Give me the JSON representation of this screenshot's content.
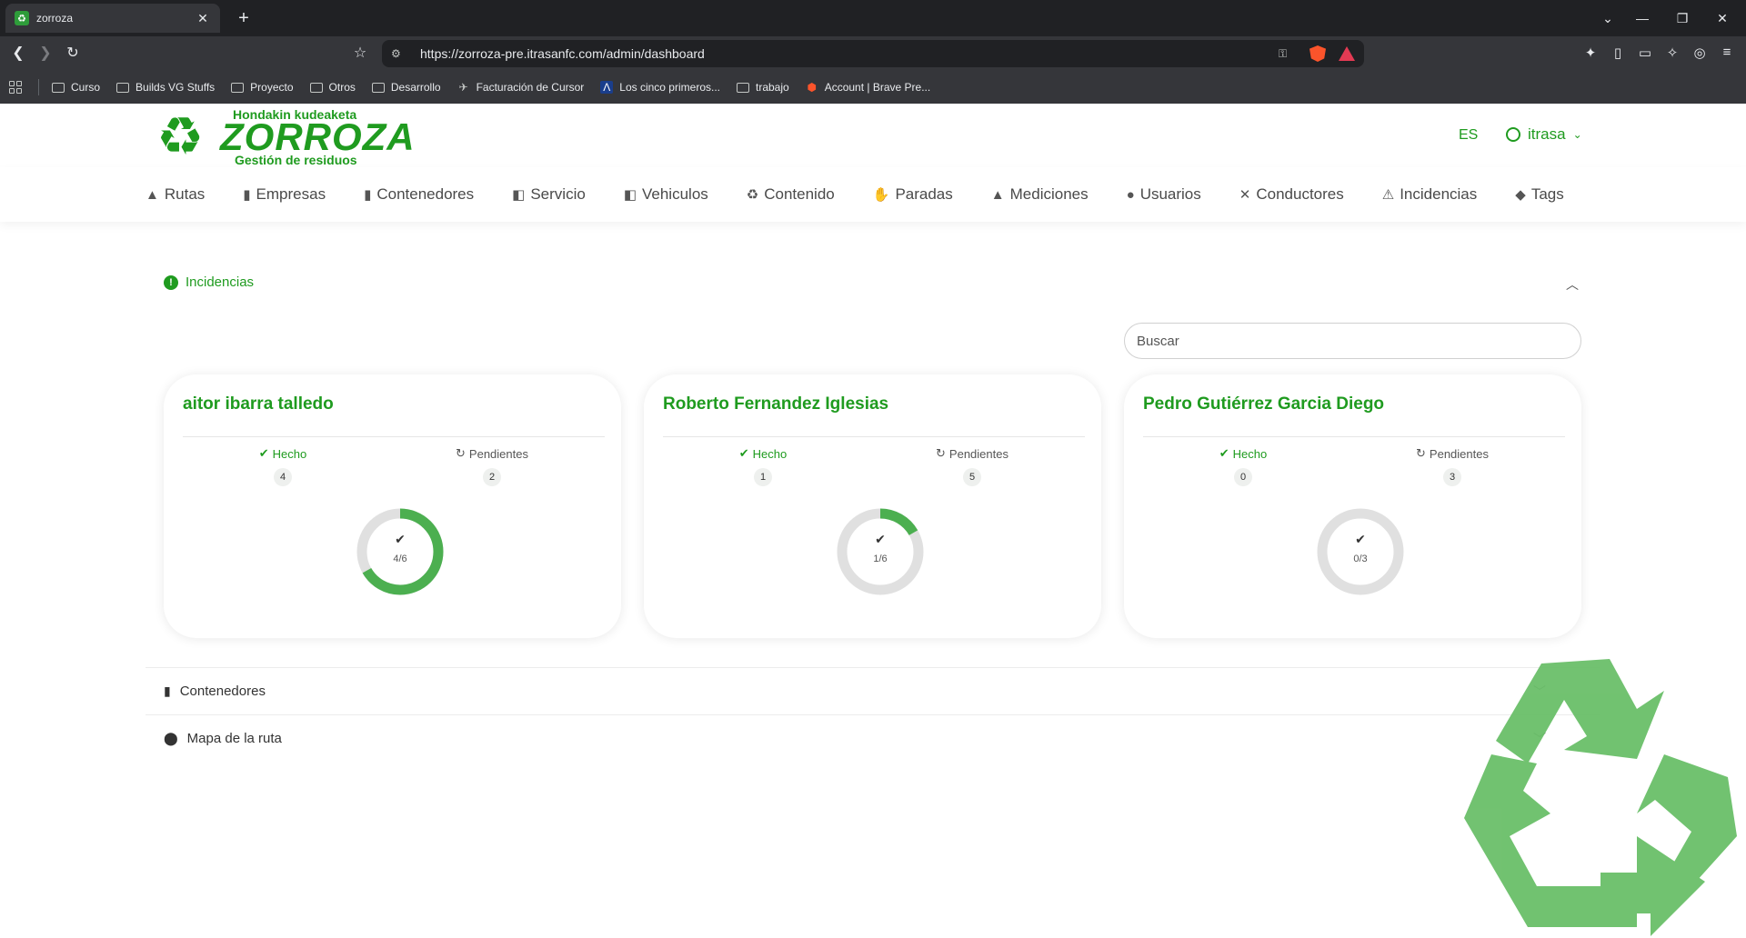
{
  "browser": {
    "tab_title": "zorroza",
    "url": "https://zorroza-pre.itrasanfc.com/admin/dashboard",
    "bookmarks": [
      {
        "label": "Curso",
        "icon": "folder-icon"
      },
      {
        "label": "Builds VG Stuffs",
        "icon": "folder-icon"
      },
      {
        "label": "Proyecto",
        "icon": "folder-icon"
      },
      {
        "label": "Otros",
        "icon": "folder-icon"
      },
      {
        "label": "Desarrollo",
        "icon": "folder-icon"
      },
      {
        "label": "Facturación de Cursor",
        "icon": "cursor-icon"
      },
      {
        "label": "Los cinco primeros...",
        "icon": "page-icon"
      },
      {
        "label": "trabajo",
        "icon": "folder-icon"
      },
      {
        "label": "Account | Brave Pre...",
        "icon": "brave-icon"
      }
    ]
  },
  "header": {
    "logo_top": "Hondakin kudeaketa",
    "logo_main": "ZORROZA",
    "logo_sub": "Gestión de residuos",
    "lang": "ES",
    "username": "itrasa"
  },
  "nav": [
    {
      "label": "Rutas",
      "icon": "route-icon",
      "glyph": "▲"
    },
    {
      "label": "Empresas",
      "icon": "building-icon",
      "glyph": "▮"
    },
    {
      "label": "Contenedores",
      "icon": "trash-icon",
      "glyph": "▮"
    },
    {
      "label": "Servicio",
      "icon": "truck-ramp-icon",
      "glyph": "◧"
    },
    {
      "label": "Vehiculos",
      "icon": "truck-icon",
      "glyph": "◧"
    },
    {
      "label": "Contenido",
      "icon": "recycle-icon",
      "glyph": "♻"
    },
    {
      "label": "Paradas",
      "icon": "hand-icon",
      "glyph": "✋"
    },
    {
      "label": "Mediciones",
      "icon": "weight-icon",
      "glyph": "▲"
    },
    {
      "label": "Usuarios",
      "icon": "users-icon",
      "glyph": "●"
    },
    {
      "label": "Conductores",
      "icon": "driver-icon",
      "glyph": "✕"
    },
    {
      "label": "Incidencias",
      "icon": "warning-icon",
      "glyph": "⚠"
    },
    {
      "label": "Tags",
      "icon": "tags-icon",
      "glyph": "◆"
    }
  ],
  "incidencias": {
    "title": "Incidencias",
    "search_placeholder": "Buscar",
    "done_label": "Hecho",
    "pending_label": "Pendientes",
    "cards": [
      {
        "name": "aitor ibarra talledo",
        "done": 4,
        "pending": 2,
        "progress_text": "4/6",
        "progress_fraction": 0.667
      },
      {
        "name": "Roberto Fernandez Iglesias",
        "done": 1,
        "pending": 5,
        "progress_text": "1/6",
        "progress_fraction": 0.167
      },
      {
        "name": "Pedro Gutiérrez Garcia Diego",
        "done": 0,
        "pending": 3,
        "progress_text": "0/3",
        "progress_fraction": 0
      }
    ]
  },
  "sections": {
    "contenedores": "Contenedores",
    "mapa": "Mapa de la ruta"
  },
  "colors": {
    "brand_green": "#1f9b1f",
    "donut_green": "#4caf50",
    "donut_track": "#e0e0e0",
    "watermark_green": "#6abf69"
  }
}
